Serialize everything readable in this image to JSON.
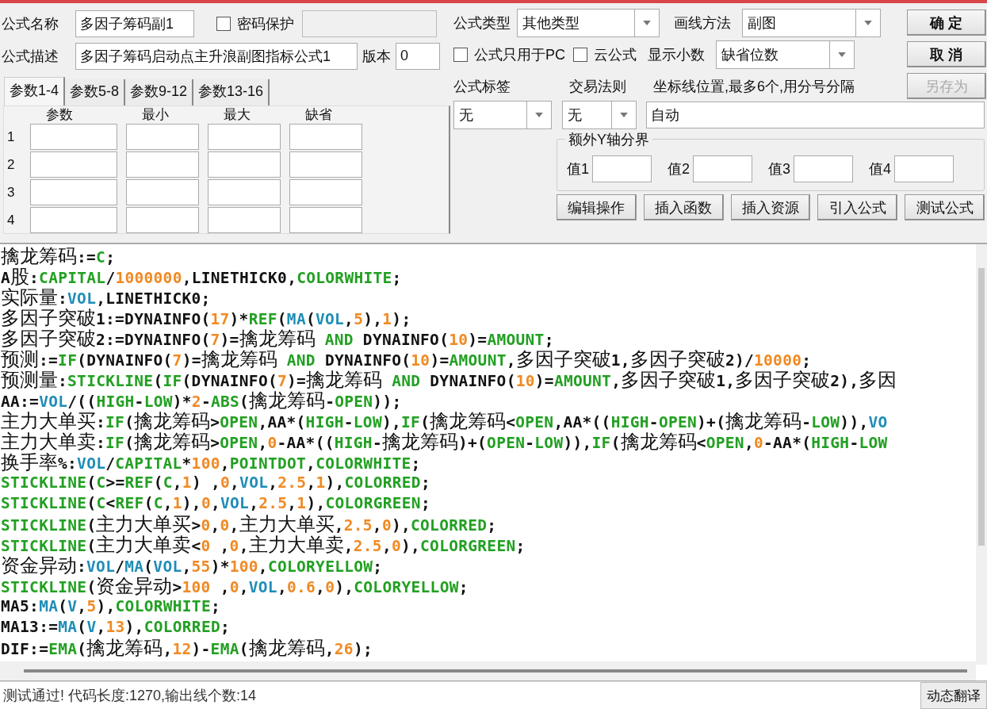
{
  "form": {
    "name_label": "公式名称",
    "name_value": "多因子筹码副1",
    "password": {
      "label": "密码保护",
      "checked": false
    },
    "desc_label": "公式描述",
    "desc_value": "多因子筹码启动点主升浪副图指标公式1",
    "version_label": "版本",
    "version_value": "0"
  },
  "param_tabs": [
    {
      "label": "参数1-4",
      "selected": true
    },
    {
      "label": "参数5-8",
      "selected": false
    },
    {
      "label": "参数9-12",
      "selected": false
    },
    {
      "label": "参数13-16",
      "selected": false
    }
  ],
  "param_table": {
    "columns": [
      "参数",
      "最小",
      "最大",
      "缺省"
    ],
    "rows": [
      "1",
      "2",
      "3",
      "4"
    ]
  },
  "formula_type": {
    "label": "公式类型",
    "value": "其他类型"
  },
  "draw_method": {
    "label": "画线方法",
    "value": "副图"
  },
  "options": [
    {
      "label": "公式只用于PC",
      "checked": false
    },
    {
      "label": "云公式",
      "checked": false
    }
  ],
  "decimals": {
    "label": "显示小数",
    "value": "缺省位数"
  },
  "side_buttons": [
    {
      "label": "确 定",
      "disabled": false
    },
    {
      "label": "取 消",
      "disabled": false
    },
    {
      "label": "另存为",
      "disabled": true
    }
  ],
  "tag": {
    "label": "公式标签",
    "value": "无"
  },
  "trade_rule": {
    "label": "交易法则",
    "value": "无"
  },
  "axis": {
    "label": "坐标线位置,最多6个,用分号分隔",
    "value": "自动"
  },
  "extra_y": {
    "title": "额外Y轴分界",
    "fields": [
      "值1",
      "值2",
      "值3",
      "值4"
    ]
  },
  "tool_buttons": [
    "编辑操作",
    "插入函数",
    "插入资源",
    "引入公式",
    "测试公式"
  ],
  "code_lines": [
    [
      {
        "kind": "plain",
        "text": "擒龙筹码:="
      },
      {
        "kind": "func",
        "text": "C"
      },
      {
        "kind": "plain",
        "text": ";"
      }
    ],
    [
      {
        "kind": "plain",
        "text": "A股:"
      },
      {
        "kind": "func",
        "text": "CAPITAL"
      },
      {
        "kind": "plain",
        "text": "/"
      },
      {
        "kind": "number",
        "text": "1000000"
      },
      {
        "kind": "plain",
        "text": ",LINETHICK0,"
      },
      {
        "kind": "func",
        "text": "COLORWHITE"
      },
      {
        "kind": "plain",
        "text": ";"
      }
    ],
    [
      {
        "kind": "plain",
        "text": "实际量:"
      },
      {
        "kind": "var",
        "text": "VOL"
      },
      {
        "kind": "plain",
        "text": ",LINETHICK0;"
      }
    ],
    [
      {
        "kind": "plain",
        "text": "多因子突破1:=DYNAINFO("
      },
      {
        "kind": "number",
        "text": "17"
      },
      {
        "kind": "plain",
        "text": ")*"
      },
      {
        "kind": "func",
        "text": "REF"
      },
      {
        "kind": "plain",
        "text": "("
      },
      {
        "kind": "var",
        "text": "MA"
      },
      {
        "kind": "plain",
        "text": "("
      },
      {
        "kind": "var",
        "text": "VOL"
      },
      {
        "kind": "plain",
        "text": ","
      },
      {
        "kind": "number",
        "text": "5"
      },
      {
        "kind": "plain",
        "text": "),"
      },
      {
        "kind": "number",
        "text": "1"
      },
      {
        "kind": "plain",
        "text": ");"
      }
    ],
    [
      {
        "kind": "plain",
        "text": "多因子突破2:=DYNAINFO("
      },
      {
        "kind": "number",
        "text": "7"
      },
      {
        "kind": "plain",
        "text": ")=擒龙筹码 "
      },
      {
        "kind": "func",
        "text": "AND"
      },
      {
        "kind": "plain",
        "text": " DYNAINFO("
      },
      {
        "kind": "number",
        "text": "10"
      },
      {
        "kind": "plain",
        "text": ")="
      },
      {
        "kind": "func",
        "text": "AMOUNT"
      },
      {
        "kind": "plain",
        "text": ";"
      }
    ],
    [
      {
        "kind": "plain",
        "text": "预测:="
      },
      {
        "kind": "func",
        "text": "IF"
      },
      {
        "kind": "plain",
        "text": "(DYNAINFO("
      },
      {
        "kind": "number",
        "text": "7"
      },
      {
        "kind": "plain",
        "text": ")=擒龙筹码 "
      },
      {
        "kind": "func",
        "text": "AND"
      },
      {
        "kind": "plain",
        "text": " DYNAINFO("
      },
      {
        "kind": "number",
        "text": "10"
      },
      {
        "kind": "plain",
        "text": ")="
      },
      {
        "kind": "func",
        "text": "AMOUNT"
      },
      {
        "kind": "plain",
        "text": ",多因子突破1,多因子突破2)/"
      },
      {
        "kind": "number",
        "text": "10000"
      },
      {
        "kind": "plain",
        "text": ";"
      }
    ],
    [
      {
        "kind": "plain",
        "text": "预测量:"
      },
      {
        "kind": "func",
        "text": "STICKLINE"
      },
      {
        "kind": "plain",
        "text": "("
      },
      {
        "kind": "func",
        "text": "IF"
      },
      {
        "kind": "plain",
        "text": "(DYNAINFO("
      },
      {
        "kind": "number",
        "text": "7"
      },
      {
        "kind": "plain",
        "text": ")=擒龙筹码 "
      },
      {
        "kind": "func",
        "text": "AND"
      },
      {
        "kind": "plain",
        "text": " DYNAINFO("
      },
      {
        "kind": "number",
        "text": "10"
      },
      {
        "kind": "plain",
        "text": ")="
      },
      {
        "kind": "func",
        "text": "AMOUNT"
      },
      {
        "kind": "plain",
        "text": ",多因子突破1,多因子突破2),多因"
      }
    ],
    [
      {
        "kind": "plain",
        "text": "AA:="
      },
      {
        "kind": "var",
        "text": "VOL"
      },
      {
        "kind": "plain",
        "text": "/(("
      },
      {
        "kind": "func",
        "text": "HIGH"
      },
      {
        "kind": "plain",
        "text": "-"
      },
      {
        "kind": "func",
        "text": "LOW"
      },
      {
        "kind": "plain",
        "text": ")*"
      },
      {
        "kind": "number",
        "text": "2"
      },
      {
        "kind": "plain",
        "text": "-"
      },
      {
        "kind": "func",
        "text": "ABS"
      },
      {
        "kind": "plain",
        "text": "(擒龙筹码-"
      },
      {
        "kind": "func",
        "text": "OPEN"
      },
      {
        "kind": "plain",
        "text": "));"
      }
    ],
    [
      {
        "kind": "plain",
        "text": "主力大单买:"
      },
      {
        "kind": "func",
        "text": "IF"
      },
      {
        "kind": "plain",
        "text": "(擒龙筹码>"
      },
      {
        "kind": "func",
        "text": "OPEN"
      },
      {
        "kind": "plain",
        "text": ",AA*("
      },
      {
        "kind": "func",
        "text": "HIGH"
      },
      {
        "kind": "plain",
        "text": "-"
      },
      {
        "kind": "func",
        "text": "LOW"
      },
      {
        "kind": "plain",
        "text": "),"
      },
      {
        "kind": "func",
        "text": "IF"
      },
      {
        "kind": "plain",
        "text": "(擒龙筹码<"
      },
      {
        "kind": "func",
        "text": "OPEN"
      },
      {
        "kind": "plain",
        "text": ",AA*(("
      },
      {
        "kind": "func",
        "text": "HIGH"
      },
      {
        "kind": "plain",
        "text": "-"
      },
      {
        "kind": "func",
        "text": "OPEN"
      },
      {
        "kind": "plain",
        "text": ")+(擒龙筹码-"
      },
      {
        "kind": "func",
        "text": "LOW"
      },
      {
        "kind": "plain",
        "text": ")),"
      },
      {
        "kind": "var",
        "text": "VO"
      }
    ],
    [
      {
        "kind": "plain",
        "text": "主力大单卖:"
      },
      {
        "kind": "func",
        "text": "IF"
      },
      {
        "kind": "plain",
        "text": "(擒龙筹码>"
      },
      {
        "kind": "func",
        "text": "OPEN"
      },
      {
        "kind": "plain",
        "text": ","
      },
      {
        "kind": "number",
        "text": "0"
      },
      {
        "kind": "plain",
        "text": "-AA*(("
      },
      {
        "kind": "func",
        "text": "HIGH"
      },
      {
        "kind": "plain",
        "text": "-擒龙筹码)+("
      },
      {
        "kind": "func",
        "text": "OPEN"
      },
      {
        "kind": "plain",
        "text": "-"
      },
      {
        "kind": "func",
        "text": "LOW"
      },
      {
        "kind": "plain",
        "text": ")),"
      },
      {
        "kind": "func",
        "text": "IF"
      },
      {
        "kind": "plain",
        "text": "(擒龙筹码<"
      },
      {
        "kind": "func",
        "text": "OPEN"
      },
      {
        "kind": "plain",
        "text": ","
      },
      {
        "kind": "number",
        "text": "0"
      },
      {
        "kind": "plain",
        "text": "-AA*("
      },
      {
        "kind": "func",
        "text": "HIGH"
      },
      {
        "kind": "plain",
        "text": "-"
      },
      {
        "kind": "func",
        "text": "LOW"
      }
    ],
    [
      {
        "kind": "plain",
        "text": "换手率%:"
      },
      {
        "kind": "var",
        "text": "VOL"
      },
      {
        "kind": "plain",
        "text": "/"
      },
      {
        "kind": "func",
        "text": "CAPITAL"
      },
      {
        "kind": "plain",
        "text": "*"
      },
      {
        "kind": "number",
        "text": "100"
      },
      {
        "kind": "plain",
        "text": ","
      },
      {
        "kind": "func",
        "text": "POINTDOT"
      },
      {
        "kind": "plain",
        "text": ","
      },
      {
        "kind": "func",
        "text": "COLORWHITE"
      },
      {
        "kind": "plain",
        "text": ";"
      }
    ],
    [
      {
        "kind": "func",
        "text": "STICKLINE"
      },
      {
        "kind": "plain",
        "text": "("
      },
      {
        "kind": "func",
        "text": "C"
      },
      {
        "kind": "plain",
        "text": ">="
      },
      {
        "kind": "func",
        "text": "REF"
      },
      {
        "kind": "plain",
        "text": "("
      },
      {
        "kind": "func",
        "text": "C"
      },
      {
        "kind": "plain",
        "text": ","
      },
      {
        "kind": "number",
        "text": "1"
      },
      {
        "kind": "plain",
        "text": ") ,"
      },
      {
        "kind": "number",
        "text": "0"
      },
      {
        "kind": "plain",
        "text": ","
      },
      {
        "kind": "var",
        "text": "VOL"
      },
      {
        "kind": "plain",
        "text": ","
      },
      {
        "kind": "number",
        "text": "2.5"
      },
      {
        "kind": "plain",
        "text": ","
      },
      {
        "kind": "number",
        "text": "1"
      },
      {
        "kind": "plain",
        "text": "),"
      },
      {
        "kind": "func",
        "text": "COLORRED"
      },
      {
        "kind": "plain",
        "text": ";"
      }
    ],
    [
      {
        "kind": "func",
        "text": "STICKLINE"
      },
      {
        "kind": "plain",
        "text": "("
      },
      {
        "kind": "func",
        "text": "C"
      },
      {
        "kind": "plain",
        "text": "<"
      },
      {
        "kind": "func",
        "text": "REF"
      },
      {
        "kind": "plain",
        "text": "("
      },
      {
        "kind": "func",
        "text": "C"
      },
      {
        "kind": "plain",
        "text": ","
      },
      {
        "kind": "number",
        "text": "1"
      },
      {
        "kind": "plain",
        "text": "),"
      },
      {
        "kind": "number",
        "text": "0"
      },
      {
        "kind": "plain",
        "text": ","
      },
      {
        "kind": "var",
        "text": "VOL"
      },
      {
        "kind": "plain",
        "text": ","
      },
      {
        "kind": "number",
        "text": "2.5"
      },
      {
        "kind": "plain",
        "text": ","
      },
      {
        "kind": "number",
        "text": "1"
      },
      {
        "kind": "plain",
        "text": "),"
      },
      {
        "kind": "func",
        "text": "COLORGREEN"
      },
      {
        "kind": "plain",
        "text": ";"
      }
    ],
    [
      {
        "kind": "func",
        "text": "STICKLINE"
      },
      {
        "kind": "plain",
        "text": "(主力大单买>"
      },
      {
        "kind": "number",
        "text": "0"
      },
      {
        "kind": "plain",
        "text": ","
      },
      {
        "kind": "number",
        "text": "0"
      },
      {
        "kind": "plain",
        "text": ",主力大单买,"
      },
      {
        "kind": "number",
        "text": "2.5"
      },
      {
        "kind": "plain",
        "text": ","
      },
      {
        "kind": "number",
        "text": "0"
      },
      {
        "kind": "plain",
        "text": "),"
      },
      {
        "kind": "func",
        "text": "COLORRED"
      },
      {
        "kind": "plain",
        "text": ";"
      }
    ],
    [
      {
        "kind": "func",
        "text": "STICKLINE"
      },
      {
        "kind": "plain",
        "text": "(主力大单卖<"
      },
      {
        "kind": "number",
        "text": "0"
      },
      {
        "kind": "plain",
        "text": " ,"
      },
      {
        "kind": "number",
        "text": "0"
      },
      {
        "kind": "plain",
        "text": ",主力大单卖,"
      },
      {
        "kind": "number",
        "text": "2.5"
      },
      {
        "kind": "plain",
        "text": ","
      },
      {
        "kind": "number",
        "text": "0"
      },
      {
        "kind": "plain",
        "text": "),"
      },
      {
        "kind": "func",
        "text": "COLORGREEN"
      },
      {
        "kind": "plain",
        "text": ";"
      }
    ],
    [
      {
        "kind": "plain",
        "text": "资金异动:"
      },
      {
        "kind": "var",
        "text": "VOL"
      },
      {
        "kind": "plain",
        "text": "/"
      },
      {
        "kind": "var",
        "text": "MA"
      },
      {
        "kind": "plain",
        "text": "("
      },
      {
        "kind": "var",
        "text": "VOL"
      },
      {
        "kind": "plain",
        "text": ","
      },
      {
        "kind": "number",
        "text": "55"
      },
      {
        "kind": "plain",
        "text": ")*"
      },
      {
        "kind": "number",
        "text": "100"
      },
      {
        "kind": "plain",
        "text": ","
      },
      {
        "kind": "func",
        "text": "COLORYELLOW"
      },
      {
        "kind": "plain",
        "text": ";"
      }
    ],
    [
      {
        "kind": "func",
        "text": "STICKLINE"
      },
      {
        "kind": "plain",
        "text": "(资金异动>"
      },
      {
        "kind": "number",
        "text": "100"
      },
      {
        "kind": "plain",
        "text": " ,"
      },
      {
        "kind": "number",
        "text": "0"
      },
      {
        "kind": "plain",
        "text": ","
      },
      {
        "kind": "var",
        "text": "VOL"
      },
      {
        "kind": "plain",
        "text": ","
      },
      {
        "kind": "number",
        "text": "0.6"
      },
      {
        "kind": "plain",
        "text": ","
      },
      {
        "kind": "number",
        "text": "0"
      },
      {
        "kind": "plain",
        "text": "),"
      },
      {
        "kind": "func",
        "text": "COLORYELLOW"
      },
      {
        "kind": "plain",
        "text": ";"
      }
    ],
    [
      {
        "kind": "plain",
        "text": "MA5:"
      },
      {
        "kind": "var",
        "text": "MA"
      },
      {
        "kind": "plain",
        "text": "("
      },
      {
        "kind": "var",
        "text": "V"
      },
      {
        "kind": "plain",
        "text": ","
      },
      {
        "kind": "number",
        "text": "5"
      },
      {
        "kind": "plain",
        "text": "),"
      },
      {
        "kind": "func",
        "text": "COLORWHITE"
      },
      {
        "kind": "plain",
        "text": ";"
      }
    ],
    [
      {
        "kind": "plain",
        "text": "MA13:="
      },
      {
        "kind": "var",
        "text": "MA"
      },
      {
        "kind": "plain",
        "text": "("
      },
      {
        "kind": "var",
        "text": "V"
      },
      {
        "kind": "plain",
        "text": ","
      },
      {
        "kind": "number",
        "text": "13"
      },
      {
        "kind": "plain",
        "text": "),"
      },
      {
        "kind": "func",
        "text": "COLORRED"
      },
      {
        "kind": "plain",
        "text": ";"
      }
    ],
    [
      {
        "kind": "plain",
        "text": "DIF:="
      },
      {
        "kind": "func",
        "text": "EMA"
      },
      {
        "kind": "plain",
        "text": "(擒龙筹码,"
      },
      {
        "kind": "number",
        "text": "12"
      },
      {
        "kind": "plain",
        "text": ")-"
      },
      {
        "kind": "func",
        "text": "EMA"
      },
      {
        "kind": "plain",
        "text": "(擒龙筹码,"
      },
      {
        "kind": "number",
        "text": "26"
      },
      {
        "kind": "plain",
        "text": ");"
      }
    ]
  ],
  "status_bar": {
    "text": "测试通过! 代码长度:1270,输出线个数:14",
    "button": "动态翻译"
  }
}
